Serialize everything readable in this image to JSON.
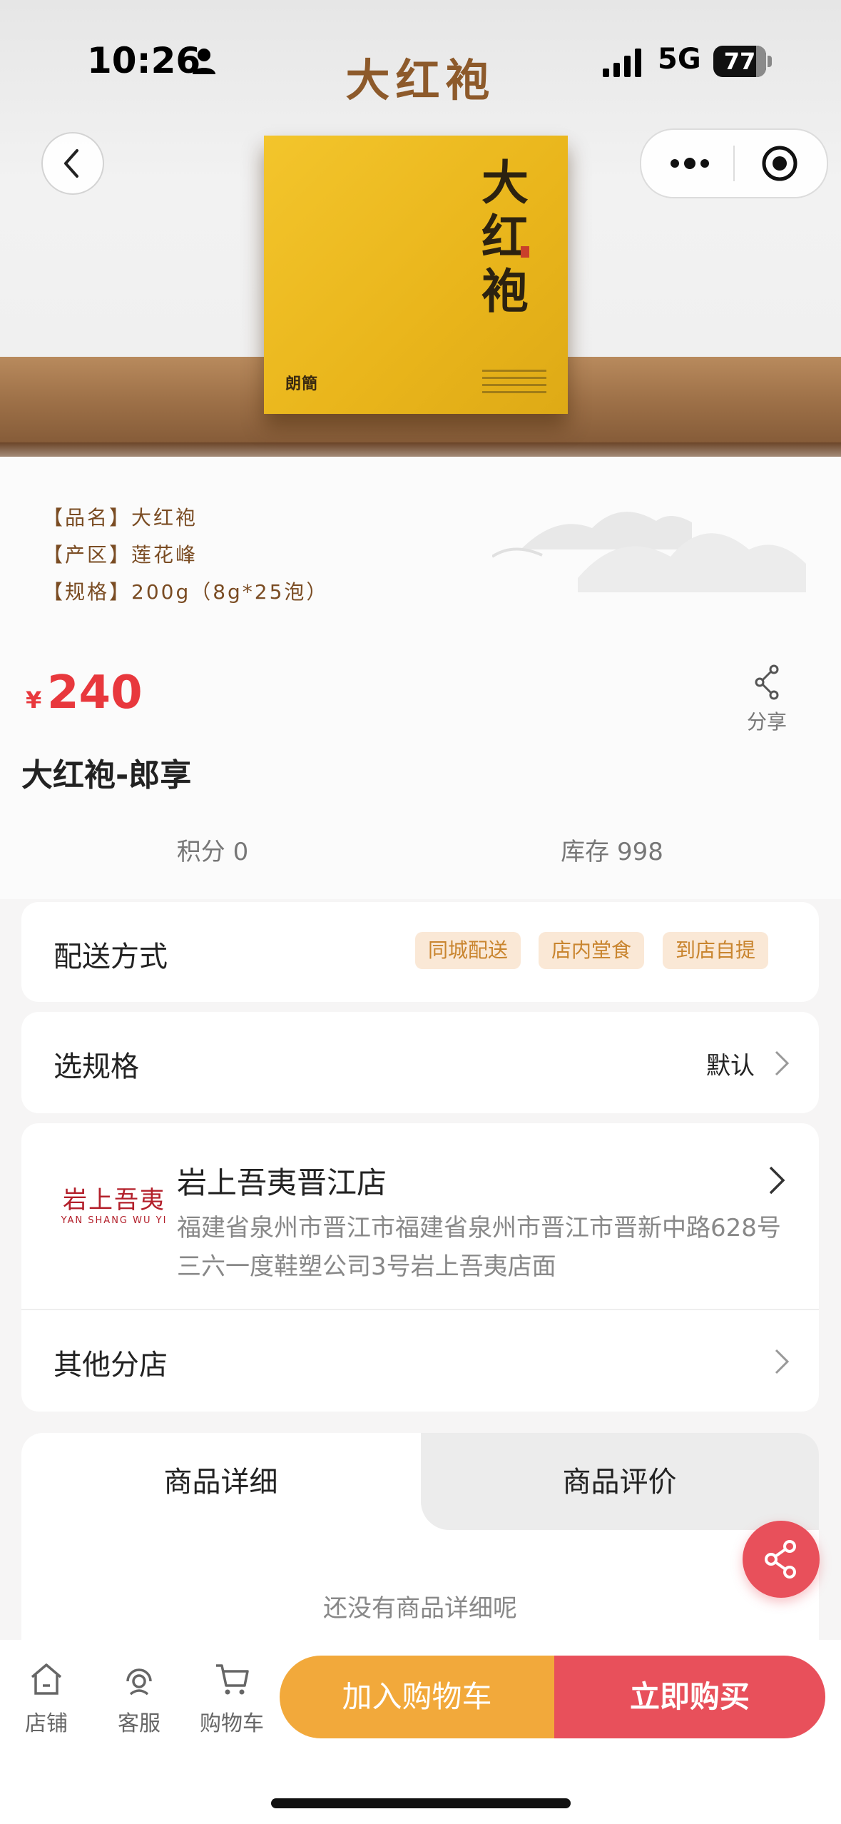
{
  "status_bar": {
    "time": "10:26",
    "network": "5G",
    "battery": "77"
  },
  "hero": {
    "banner_title": "大红袍",
    "box_title": "大红袍",
    "box_logo": "朗簡"
  },
  "spec": {
    "rows": [
      "【品名】大红袍",
      "【产区】莲花峰",
      "【规格】200g（8g*25泡）"
    ]
  },
  "product": {
    "currency": "¥",
    "price": "240",
    "name": "大红袍-郎享",
    "share_label": "分享",
    "points": "积分 0",
    "stock": "库存 998"
  },
  "delivery": {
    "label": "配送方式",
    "options": [
      "同城配送",
      "店内堂食",
      "到店自提"
    ]
  },
  "spec_select": {
    "label": "选规格",
    "value": "默认"
  },
  "store": {
    "logo_cn": "岩上吾夷",
    "logo_en": "YAN SHANG WU YI",
    "name": "岩上吾夷晋江店",
    "address": "福建省泉州市晋江市福建省泉州市晋江市晋新中路628号三六一度鞋塑公司3号岩上吾夷店面",
    "other_label": "其他分店"
  },
  "tabs": {
    "active": "商品详细",
    "inactive": "商品评价",
    "empty_text": "还没有商品详细呢"
  },
  "bottom_nav": {
    "items": [
      "店铺",
      "客服",
      "购物车"
    ],
    "add_cart": "加入购物车",
    "buy_now": "立即购买"
  },
  "colors": {
    "price_red": "#e8383d",
    "buy_red": "#e8505b",
    "cart_orange": "#f2a93b",
    "chip_bg": "#fae8d6",
    "chip_text": "#c9852f"
  }
}
